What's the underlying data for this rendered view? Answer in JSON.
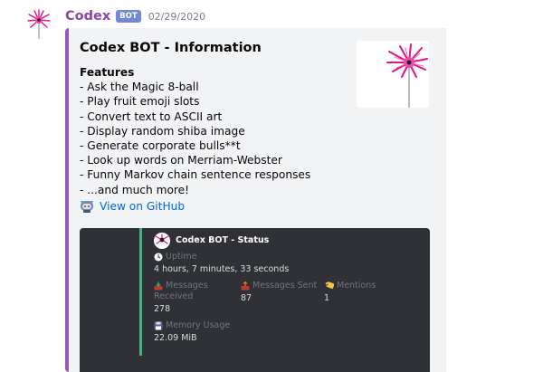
{
  "message": {
    "username": "Codex",
    "bot_tag": "BOT",
    "timestamp": "02/29/2020"
  },
  "embed": {
    "accent_color": "#9b59b6",
    "title": "Codex BOT - Information",
    "features_heading": "Features",
    "features": [
      "- Ask the Magic 8-ball",
      "- Play fruit emoji slots",
      "- Convert text to ASCII art",
      "- Display random shiba image",
      "- Generate corporate bulls**t",
      "- Look up words on Merriam-Webster",
      "- Funny Markov chain sentence responses",
      "- ...and much more!"
    ],
    "link_icon": "octocat-icon",
    "link_label": "View on GitHub"
  },
  "status_screenshot": {
    "accent_color": "#43b581",
    "title": "Codex BOT - Status",
    "uptime_label": "Uptime",
    "uptime_value": "4 hours, 7 minutes, 33 seconds",
    "messages_received_label": "Messages",
    "messages_received_label_2": "Received",
    "messages_received_value": "278",
    "messages_sent_label": "Messages Sent",
    "messages_sent_value": "87",
    "mentions_label": "Mentions",
    "mentions_value": "1",
    "memory_label": "Memory Usage",
    "memory_value": "22.09 MiB"
  }
}
